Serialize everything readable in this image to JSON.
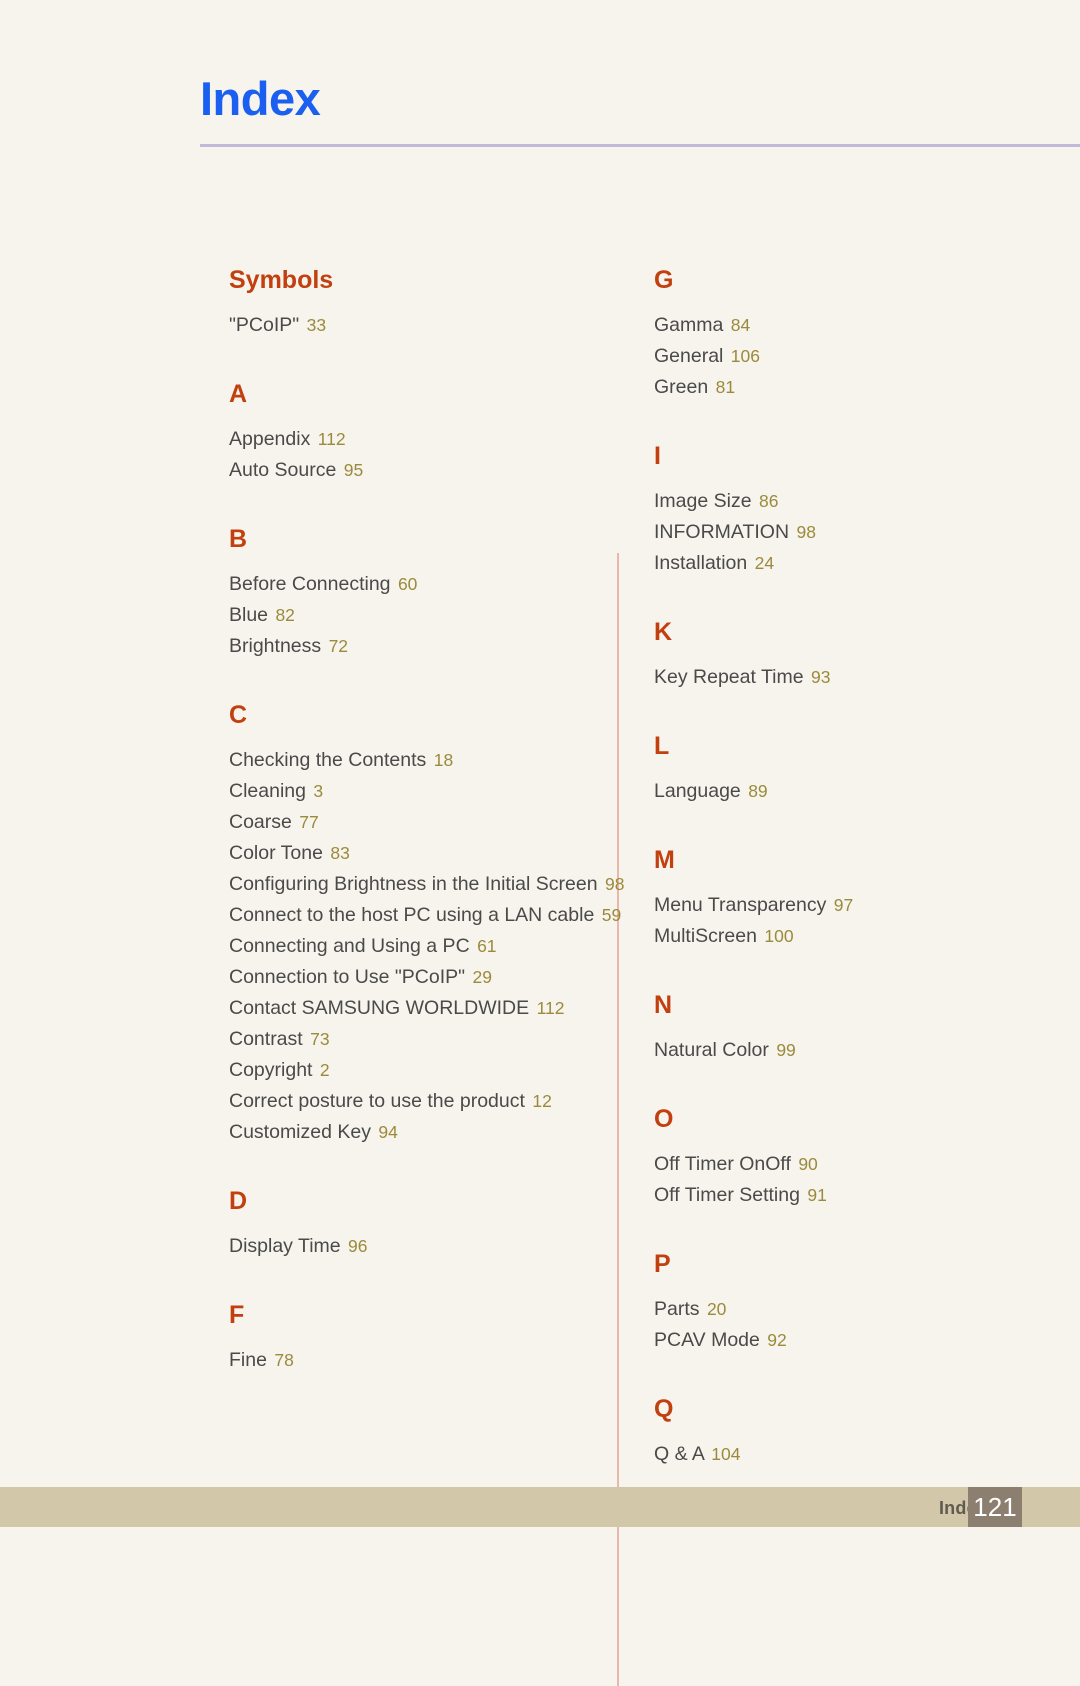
{
  "header": {
    "title": "Index"
  },
  "footer": {
    "label": "Index",
    "page_number": "121"
  },
  "colors": {
    "background": "#F6F4EC",
    "title": "#1A5FF0",
    "title_rule": "#C2B9DA",
    "section_letter": "#C2400F",
    "entry_text": "#4A4A4A",
    "entry_page": "#9C8A3C",
    "column_divider": "#E8B8AC",
    "footer_band": "#D2C7A8",
    "footer_pagenum_box": "#8C7F70",
    "footer_pagenum_text": "#FFFFFF",
    "footer_label": "#5F5A52"
  },
  "columns": [
    {
      "name": "left",
      "sections": [
        {
          "letter": "Symbols",
          "entries": [
            {
              "title": "\"PCoIP\"",
              "page": "33"
            }
          ]
        },
        {
          "letter": "A",
          "entries": [
            {
              "title": "Appendix",
              "page": "112"
            },
            {
              "title": "Auto Source",
              "page": "95"
            }
          ]
        },
        {
          "letter": "B",
          "entries": [
            {
              "title": "Before Connecting",
              "page": "60"
            },
            {
              "title": "Blue",
              "page": "82"
            },
            {
              "title": "Brightness",
              "page": "72"
            }
          ]
        },
        {
          "letter": "C",
          "entries": [
            {
              "title": "Checking the Contents",
              "page": "18"
            },
            {
              "title": "Cleaning",
              "page": "3"
            },
            {
              "title": "Coarse",
              "page": "77"
            },
            {
              "title": "Color Tone",
              "page": "83"
            },
            {
              "title": "Configuring Brightness in the Initial Screen",
              "page": "98"
            },
            {
              "title": "Connect to the host PC using a LAN cable",
              "page": "59"
            },
            {
              "title": "Connecting and Using a PC",
              "page": "61"
            },
            {
              "title": "Connection to Use \"PCoIP\"",
              "page": "29"
            },
            {
              "title": "Contact SAMSUNG WORLDWIDE",
              "page": "112"
            },
            {
              "title": "Contrast",
              "page": "73"
            },
            {
              "title": "Copyright",
              "page": "2"
            },
            {
              "title": "Correct posture to use the product",
              "page": "12"
            },
            {
              "title": "Customized Key",
              "page": "94"
            }
          ]
        },
        {
          "letter": "D",
          "entries": [
            {
              "title": "Display Time",
              "page": "96"
            }
          ]
        },
        {
          "letter": "F",
          "entries": [
            {
              "title": "Fine",
              "page": "78"
            }
          ]
        }
      ]
    },
    {
      "name": "right",
      "sections": [
        {
          "letter": "G",
          "entries": [
            {
              "title": "Gamma",
              "page": "84"
            },
            {
              "title": "General",
              "page": "106"
            },
            {
              "title": "Green",
              "page": "81"
            }
          ]
        },
        {
          "letter": "I",
          "entries": [
            {
              "title": "Image Size",
              "page": "86"
            },
            {
              "title": "INFORMATION",
              "page": "98"
            },
            {
              "title": "Installation",
              "page": "24"
            }
          ]
        },
        {
          "letter": "K",
          "entries": [
            {
              "title": "Key Repeat Time",
              "page": "93"
            }
          ]
        },
        {
          "letter": "L",
          "entries": [
            {
              "title": "Language",
              "page": "89"
            }
          ]
        },
        {
          "letter": "M",
          "entries": [
            {
              "title": "Menu Transparency",
              "page": "97"
            },
            {
              "title": "MultiScreen",
              "page": "100"
            }
          ]
        },
        {
          "letter": "N",
          "entries": [
            {
              "title": "Natural Color",
              "page": "99"
            }
          ]
        },
        {
          "letter": "O",
          "entries": [
            {
              "title": "Off Timer OnOff",
              "page": "90"
            },
            {
              "title": "Off Timer Setting",
              "page": "91"
            }
          ]
        },
        {
          "letter": "P",
          "entries": [
            {
              "title": "Parts",
              "page": "20"
            },
            {
              "title": "PCAV Mode",
              "page": "92"
            }
          ]
        },
        {
          "letter": "Q",
          "entries": [
            {
              "title": "Q & A",
              "page": "104"
            }
          ]
        }
      ]
    }
  ]
}
